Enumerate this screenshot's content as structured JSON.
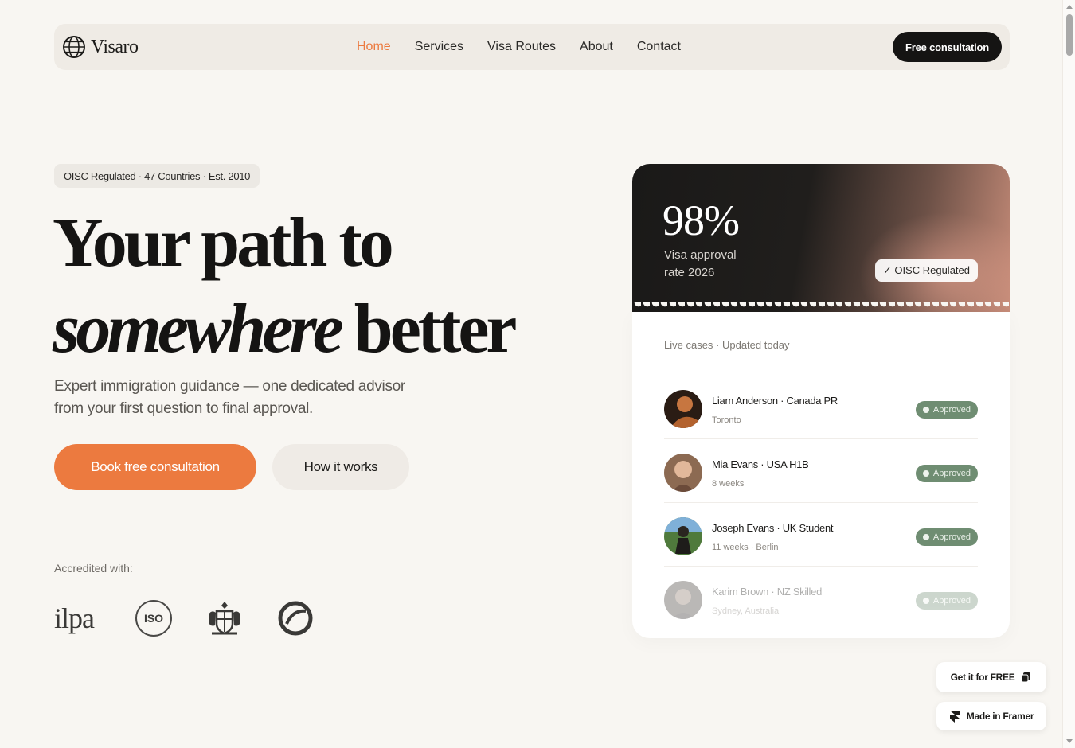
{
  "nav": {
    "brand": "Visaro",
    "links": [
      {
        "label": "Home",
        "active": true
      },
      {
        "label": "Services",
        "active": false
      },
      {
        "label": "Visa Routes",
        "active": false
      },
      {
        "label": "About",
        "active": false
      },
      {
        "label": "Contact",
        "active": false
      }
    ],
    "cta": "Free consultation"
  },
  "hero": {
    "badge": "OISC Regulated · 47 Countries · Est. 2010",
    "headline_line1": "Your path to",
    "headline_italic": "somewhere",
    "headline_rest": " better",
    "subtitle": "Expert immigration guidance — one dedicated advisor from your first question to final approval.",
    "primary_button": "Book free consultation",
    "secondary_button": "How it works",
    "accredited_label": "Accredited with:",
    "accreditations": [
      {
        "name": "ilpa",
        "icon": "ilpa-logo"
      },
      {
        "name": "ISO",
        "icon": "iso-logo"
      },
      {
        "name": "",
        "icon": "royal-crest-logo"
      },
      {
        "name": "",
        "icon": "ring-logo"
      }
    ]
  },
  "card": {
    "stat_value": "98%",
    "stat_label": "Visa approval rate 2026",
    "regulated_pill": "✓ OISC Regulated",
    "live_label": "Live cases · Updated today",
    "cases": [
      {
        "title": "Liam Anderson · Canada PR",
        "meta": "Toronto",
        "status": "Approved"
      },
      {
        "title": "Mia Evans · USA H1B",
        "meta": "8 weeks",
        "status": "Approved"
      },
      {
        "title": "Joseph Evans · UK Student",
        "meta": "11 weeks · Berlin",
        "status": "Approved"
      },
      {
        "title": "Karim Brown · NZ Skilled",
        "meta": "Sydney, Australia",
        "status": "Approved"
      }
    ]
  },
  "floating": {
    "get_free": "Get it for FREE",
    "made_in": "Made in Framer"
  },
  "colors": {
    "accent": "#ec7a3f",
    "background": "#f8f6f2",
    "dark": "#151413",
    "approved": "#6f8d72"
  }
}
